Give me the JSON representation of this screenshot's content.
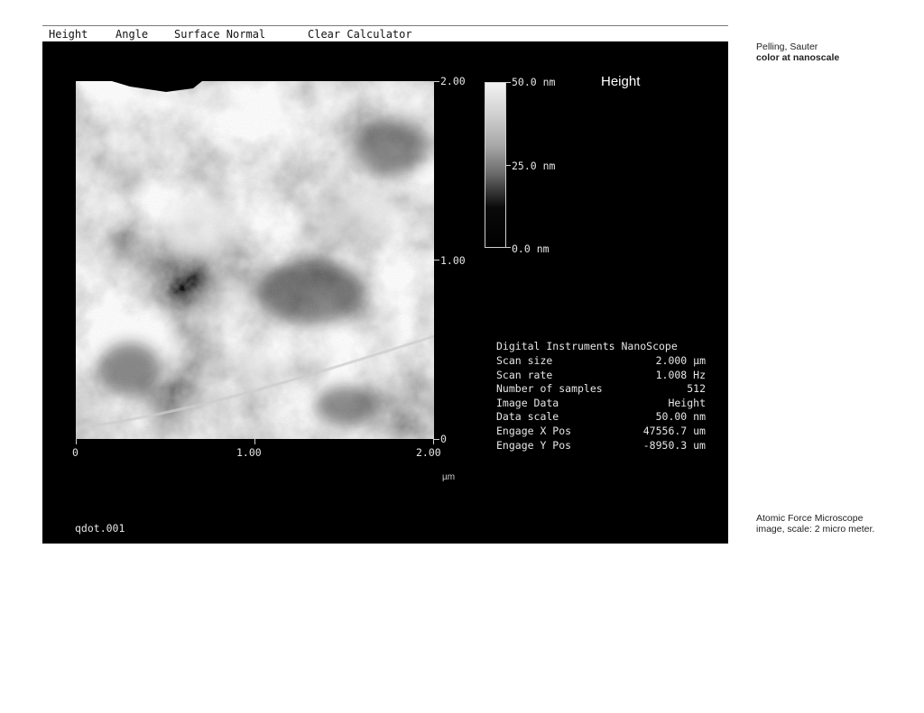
{
  "menu": [
    "Height",
    "Angle",
    "Surface Normal",
    "Clear Calculator"
  ],
  "image": {
    "title": "Height",
    "y_axis": {
      "top": "2.00",
      "mid": "1.00",
      "bottom": "0"
    },
    "x_axis": {
      "left": "0",
      "mid": "1.00",
      "right": "2.00"
    },
    "x_unit": "µm",
    "filename": "qdot.001"
  },
  "colorbar": {
    "top": "50.0 nm",
    "mid": "25.0 nm",
    "bottom": "0.0 nm"
  },
  "info": {
    "header": "Digital Instruments NanoScope",
    "rows": [
      {
        "label": "Scan size",
        "value": "2.000 µm"
      },
      {
        "label": "Scan rate",
        "value": "1.008 Hz"
      },
      {
        "label": "Number of samples",
        "value": "512"
      },
      {
        "label": "Image Data",
        "value": "Height"
      },
      {
        "label": "Data scale",
        "value": "50.00 nm"
      },
      {
        "label": "Engage X Pos",
        "value": "47556.7 um"
      },
      {
        "label": "Engage Y Pos",
        "value": "-8950.3 um"
      }
    ]
  },
  "side": {
    "authors": "Pelling, Sauter",
    "title": "color at nanoscale",
    "caption": "Atomic Force Microscope image, scale: 2 micro meter."
  }
}
